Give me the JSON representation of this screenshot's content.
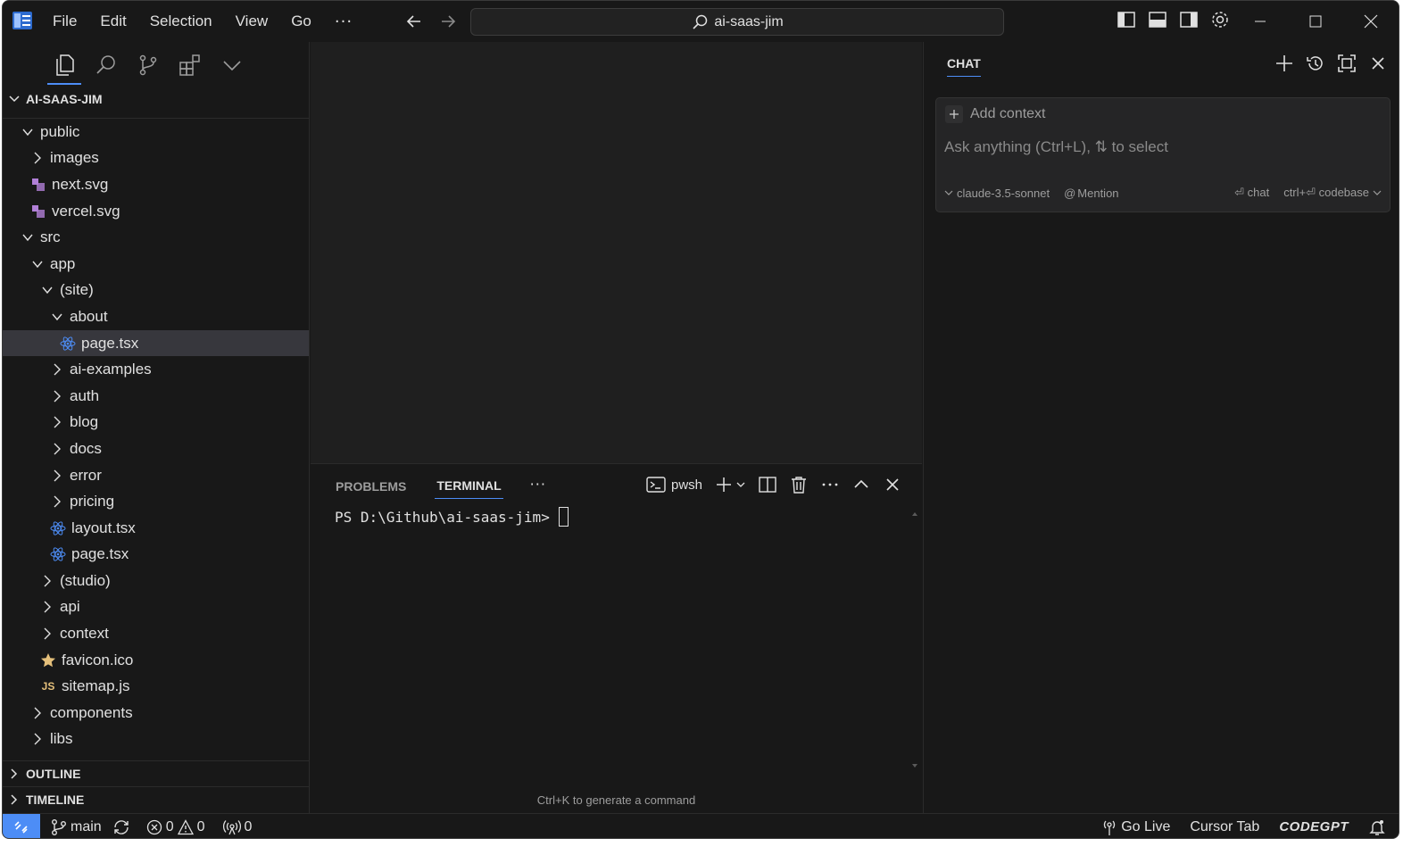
{
  "menu": {
    "items": [
      "File",
      "Edit",
      "Selection",
      "View",
      "Go"
    ],
    "more": "···"
  },
  "search": {
    "text": "ai-saas-jim"
  },
  "explorer": {
    "title": "AI-SAAS-JIM",
    "tree": [
      {
        "label": "public",
        "depth": 1,
        "type": "folder",
        "open": true
      },
      {
        "label": "images",
        "depth": 2,
        "type": "folder",
        "open": false
      },
      {
        "label": "next.svg",
        "depth": 2,
        "type": "svg"
      },
      {
        "label": "vercel.svg",
        "depth": 2,
        "type": "svg"
      },
      {
        "label": "src",
        "depth": 1,
        "type": "folder",
        "open": true
      },
      {
        "label": "app",
        "depth": 2,
        "type": "folder",
        "open": true
      },
      {
        "label": "(site)",
        "depth": 3,
        "type": "folder",
        "open": true
      },
      {
        "label": "about",
        "depth": 4,
        "type": "folder",
        "open": true
      },
      {
        "label": "page.tsx",
        "depth": 5,
        "type": "react",
        "selected": true
      },
      {
        "label": "ai-examples",
        "depth": 4,
        "type": "folder",
        "open": false
      },
      {
        "label": "auth",
        "depth": 4,
        "type": "folder",
        "open": false
      },
      {
        "label": "blog",
        "depth": 4,
        "type": "folder",
        "open": false
      },
      {
        "label": "docs",
        "depth": 4,
        "type": "folder",
        "open": false
      },
      {
        "label": "error",
        "depth": 4,
        "type": "folder",
        "open": false
      },
      {
        "label": "pricing",
        "depth": 4,
        "type": "folder",
        "open": false
      },
      {
        "label": "layout.tsx",
        "depth": 4,
        "type": "react"
      },
      {
        "label": "page.tsx",
        "depth": 4,
        "type": "react"
      },
      {
        "label": "(studio)",
        "depth": 3,
        "type": "folder",
        "open": false
      },
      {
        "label": "api",
        "depth": 3,
        "type": "folder",
        "open": false
      },
      {
        "label": "context",
        "depth": 3,
        "type": "folder",
        "open": false
      },
      {
        "label": "favicon.ico",
        "depth": 3,
        "type": "ico"
      },
      {
        "label": "sitemap.js",
        "depth": 3,
        "type": "js",
        "badge": "JS"
      },
      {
        "label": "components",
        "depth": 2,
        "type": "folder",
        "open": false
      },
      {
        "label": "libs",
        "depth": 2,
        "type": "folder",
        "open": false
      }
    ],
    "outline": "OUTLINE",
    "timeline": "TIMELINE"
  },
  "panel": {
    "tabs": [
      "PROBLEMS",
      "TERMINAL"
    ],
    "active_tab": "TERMINAL",
    "more": "···",
    "shell": "pwsh",
    "prompt": "PS D:\\Github\\ai-saas-jim>",
    "hint": "Ctrl+K to generate a command"
  },
  "chat": {
    "title": "CHAT",
    "add_context": "Add context",
    "placeholder": "Ask anything (Ctrl+L), ⇅ to select",
    "model": "claude-3.5-sonnet",
    "mention": "Mention",
    "chat_shortcut": "⏎ chat",
    "codebase_shortcut": "ctrl+⏎ codebase"
  },
  "status": {
    "branch": "main",
    "errors": "0",
    "warnings": "0",
    "ports": "0",
    "go_live": "Go Live",
    "cursor_tab": "Cursor Tab",
    "codegpt": "CODEGPT"
  },
  "colors": {
    "accent": "#4d8df6",
    "background": "#181818",
    "editor": "#1f1f1f",
    "selection": "#37373d"
  }
}
